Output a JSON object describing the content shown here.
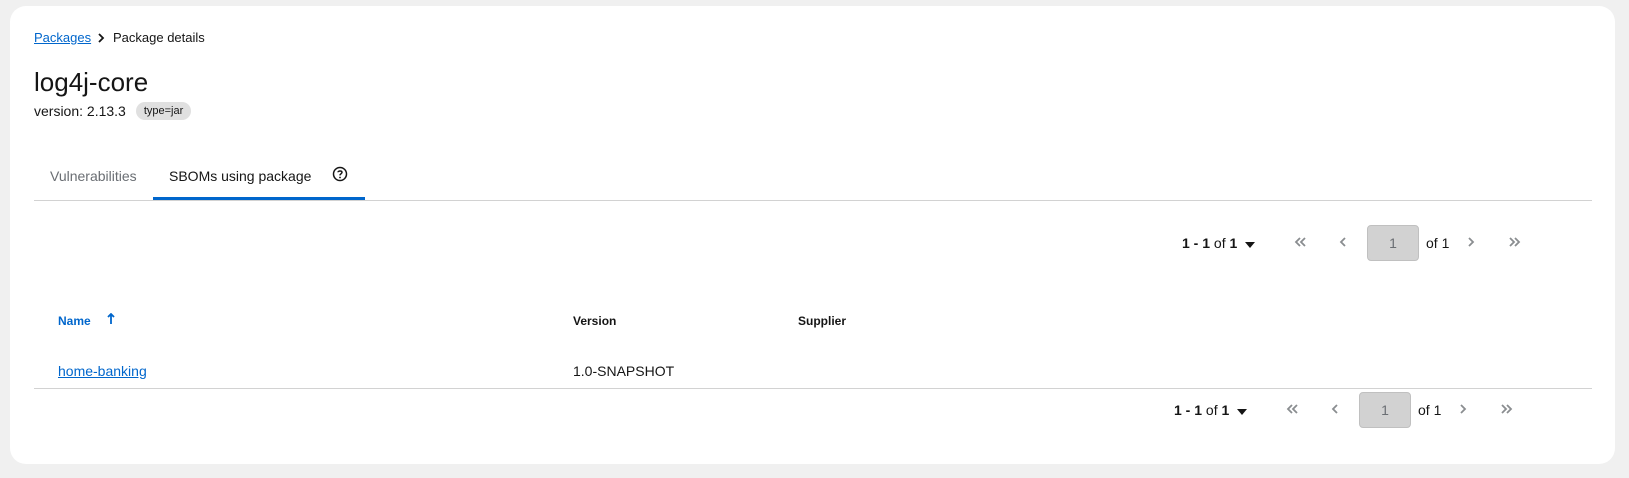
{
  "breadcrumb": {
    "link_label": "Packages",
    "current_label": "Package details"
  },
  "package": {
    "name": "log4j-core",
    "version_text": "version: 2.13.3",
    "type_badge": "type=jar"
  },
  "tabs": [
    {
      "label": "Vulnerabilities",
      "active": false
    },
    {
      "label": "SBOMs using package",
      "active": true
    }
  ],
  "pagination_top": {
    "range": "1 - 1",
    "of_word": "of",
    "total": "1",
    "page_value": "1",
    "of_pages": "of 1"
  },
  "table": {
    "columns": [
      "Name",
      "Version",
      "Supplier"
    ],
    "rows": [
      {
        "name": "home-banking",
        "version": "1.0-SNAPSHOT",
        "supplier": ""
      }
    ]
  },
  "pagination_bottom": {
    "range": "1 - 1",
    "of_word": "of",
    "total": "1",
    "page_value": "1",
    "of_pages": "of 1"
  },
  "icons": {
    "breadcrumb_sep": "chevron-right-icon",
    "help": "help-circle-icon",
    "sort": "sort-ascending-icon",
    "dropdown": "caret-down-icon",
    "first": "double-chevron-left-icon",
    "prev": "chevron-left-icon",
    "next": "chevron-right-icon",
    "last": "double-chevron-right-icon"
  },
  "colors": {
    "link": "#0066cc",
    "tab_active_underline": "#0066cc",
    "badge_bg": "#e0e0e0",
    "page_bg": "#f0f0f0"
  }
}
